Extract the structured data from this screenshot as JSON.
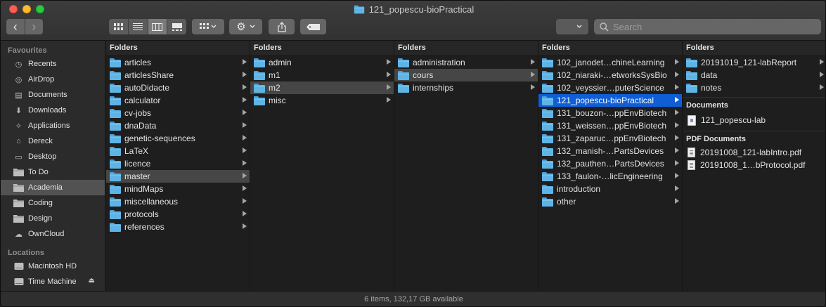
{
  "window": {
    "title": "121_popescu-bioPractical"
  },
  "toolbar": {
    "back": "‹",
    "forward": "›",
    "views": [
      "icon-view",
      "list-view",
      "column-view",
      "gallery-view"
    ],
    "active_view": 2,
    "search_placeholder": "Search"
  },
  "sidebar": {
    "favourites_label": "Favourites",
    "favourites": [
      {
        "label": "Recents",
        "icon": "clock-icon"
      },
      {
        "label": "AirDrop",
        "icon": "airdrop-icon"
      },
      {
        "label": "Documents",
        "icon": "document-icon"
      },
      {
        "label": "Downloads",
        "icon": "download-icon"
      },
      {
        "label": "Applications",
        "icon": "applications-icon"
      },
      {
        "label": "Dereck",
        "icon": "home-icon"
      },
      {
        "label": "Desktop",
        "icon": "desktop-icon"
      },
      {
        "label": "To Do",
        "icon": "folder-icon"
      },
      {
        "label": "Academia",
        "icon": "folder-icon",
        "selected": true
      },
      {
        "label": "Coding",
        "icon": "folder-icon"
      },
      {
        "label": "Design",
        "icon": "folder-icon"
      },
      {
        "label": "OwnCloud",
        "icon": "cloud-icon"
      }
    ],
    "locations_label": "Locations",
    "locations": [
      {
        "label": "Macintosh HD",
        "icon": "disk-icon"
      },
      {
        "label": "Time Machine",
        "icon": "disk-icon",
        "eject": true
      }
    ]
  },
  "columns": [
    {
      "header": "Folders",
      "items": [
        "articles",
        "articlesShare",
        "autoDidacte",
        "calculator",
        "cv-jobs",
        "dnaData",
        "genetic-sequences",
        "LaTeX",
        "licence",
        "master",
        "mindMaps",
        "miscellaneous",
        "protocols",
        "references"
      ],
      "selected": "master"
    },
    {
      "header": "Folders",
      "items": [
        "admin",
        "m1",
        "m2",
        "misc"
      ],
      "selected": "m2"
    },
    {
      "header": "Folders",
      "items": [
        "administration",
        "cours",
        "internships"
      ],
      "selected": "cours"
    },
    {
      "header": "Folders",
      "items": [
        "102_janodet…chineLearning",
        "102_niaraki-…etworksSysBio",
        "102_veyssier…puterScience",
        "121_popescu-bioPractical",
        "131_bouzon-…ppEnvBiotech",
        "131_weissen…ppEnvBiotech",
        "131_zaparuc…ppEnvBiotech",
        "132_manish-…PartsDevices",
        "132_pauthen…PartsDevices",
        "133_faulon-…licEngineering",
        "introduction",
        "other"
      ],
      "selected": "121_popescu-bioPractical"
    },
    {
      "header": "Folders",
      "items": [
        "20191019_121-labReport",
        "data",
        "notes"
      ],
      "documents_header": "Documents",
      "documents": [
        "121_popescu-lab"
      ],
      "pdf_header": "PDF Documents",
      "pdfs": [
        "20191008_121-labIntro.pdf",
        "20191008_1…bProtocol.pdf"
      ]
    }
  ],
  "status": "6 items, 132,17 GB available"
}
